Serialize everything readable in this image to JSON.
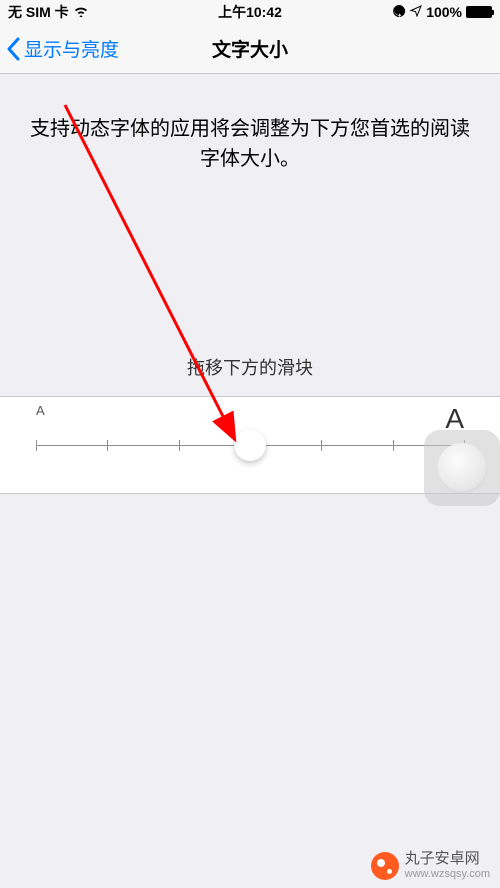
{
  "status": {
    "carrier": "无 SIM 卡",
    "time": "上午10:42",
    "battery_pct": "100%"
  },
  "nav": {
    "back_label": "显示与亮度",
    "title": "文字大小"
  },
  "content": {
    "description": "支持动态字体的应用将会调整为下方您首选的阅读字体大小。",
    "slider_instruction": "拖移下方的滑块",
    "label_small": "A",
    "label_large": "A"
  },
  "slider": {
    "steps": 7,
    "value_index": 3
  },
  "watermark": {
    "name": "丸子安卓网",
    "url": "www.wzsqsy.com"
  }
}
